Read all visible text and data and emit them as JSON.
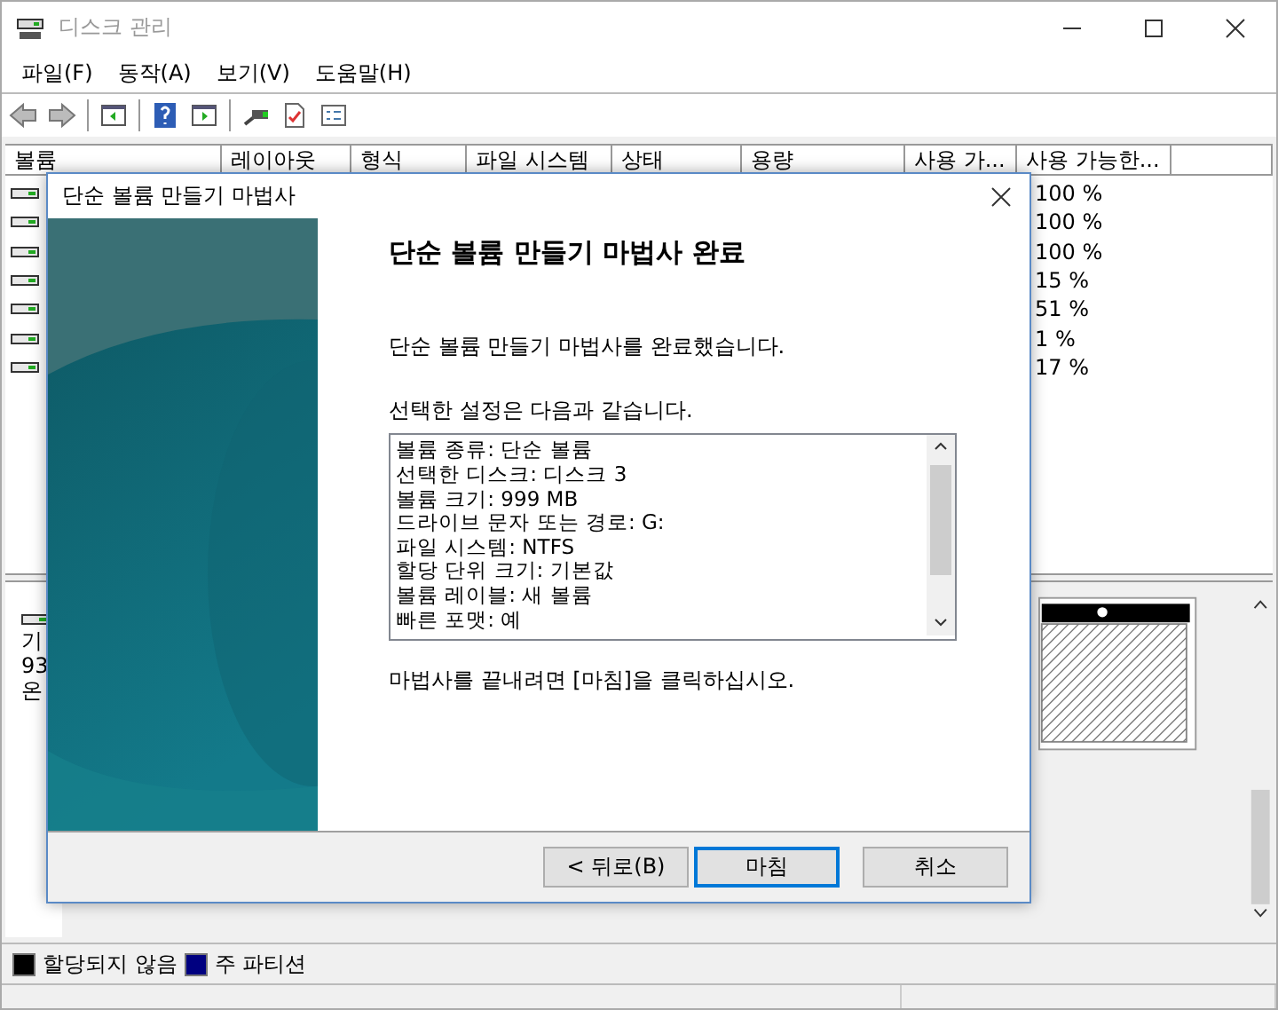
{
  "window": {
    "title": "디스크 관리"
  },
  "menu": [
    "파일(F)",
    "동작(A)",
    "보기(V)",
    "도움말(H)"
  ],
  "columns": [
    "볼륨",
    "레이아웃",
    "형식",
    "파일 시스템",
    "상태",
    "용량",
    "사용 가...",
    "사용 가능한..."
  ],
  "volumes": [
    {
      "free_percent": "100 %"
    },
    {
      "free_percent": "100 %"
    },
    {
      "free_percent": "100 %"
    },
    {
      "free_percent": "15 %"
    },
    {
      "free_percent": "51 %"
    },
    {
      "free_percent": "1 %"
    },
    {
      "free_percent": "17 %"
    }
  ],
  "disk_panel": {
    "label_fragments": [
      "기",
      "93",
      "온"
    ]
  },
  "legend": [
    {
      "label": "할당되지 않음",
      "color": "#000000"
    },
    {
      "label": "주 파티션",
      "color": "#000080"
    }
  ],
  "dialog": {
    "title": "단순 볼륨 만들기 마법사",
    "heading": "단순 볼륨 만들기 마법사 완료",
    "intro": "단순 볼륨 만들기 마법사를 완료했습니다.",
    "settings_label": "선택한 설정은 다음과 같습니다.",
    "settings": [
      "볼륨 종류: 단순 볼륨",
      "선택한 디스크: 디스크 3",
      "볼륨 크기: 999 MB",
      "드라이브 문자 또는 경로: G:",
      "파일 시스템: NTFS",
      "할당 단위 크기: 기본값",
      "볼륨 레이블: 새 볼륨",
      "빠른 포맷: 예"
    ],
    "finish_note": "마법사를 끝내려면 [마침]을 클릭하십시오.",
    "buttons": [
      {
        "label": "< 뒤로(B)",
        "default": false
      },
      {
        "label": "마침",
        "default": true
      },
      {
        "label": "취소",
        "default": false
      }
    ]
  }
}
